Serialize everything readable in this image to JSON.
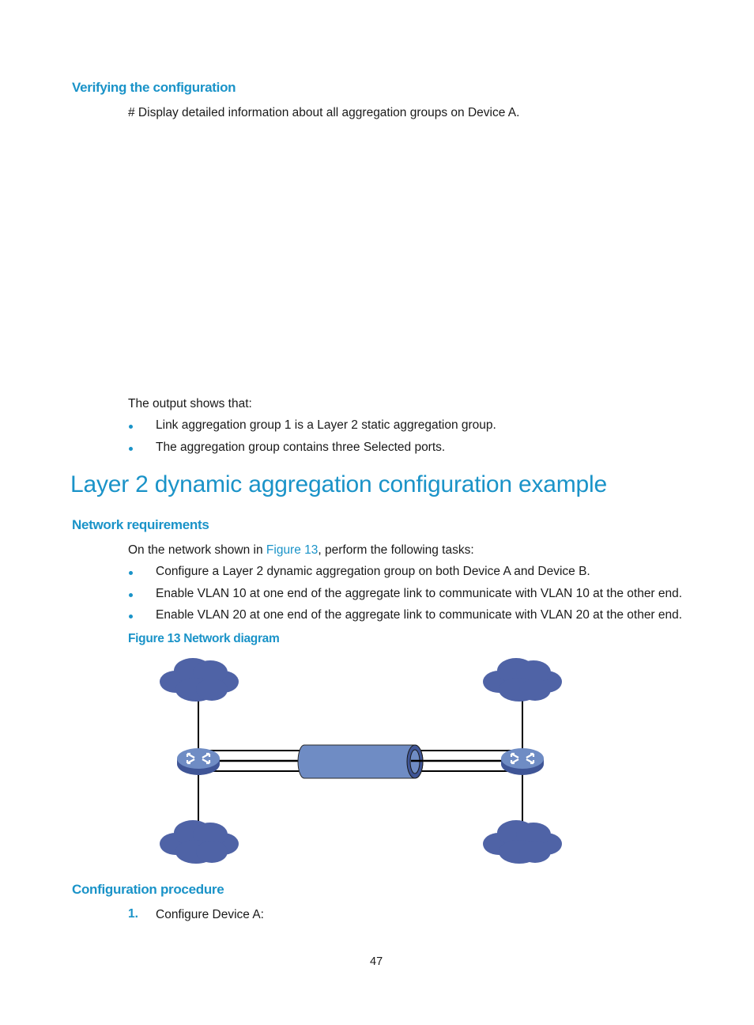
{
  "sections": {
    "verifying": {
      "heading": "Verifying the configuration",
      "intro": "# Display detailed information about all aggregation groups on Device A.",
      "output_lead": "The output shows that:",
      "bullets": [
        "Link aggregation group 1 is a Layer 2 static aggregation group.",
        "The aggregation group contains three Selected ports."
      ]
    },
    "example": {
      "title": "Layer 2 dynamic aggregation configuration example"
    },
    "network_requirements": {
      "heading": "Network requirements",
      "intro_before": "On the network shown in ",
      "intro_link": "Figure 13",
      "intro_after": ", perform the following tasks:",
      "bullets": [
        "Configure a Layer 2 dynamic aggregation group on both Device A and Device B.",
        "Enable VLAN 10 at one end of the aggregate link to communicate with VLAN 10 at the other end.",
        "Enable VLAN 20 at one end of the aggregate link to communicate with VLAN 20 at the other end."
      ],
      "figure_caption": "Figure 13 Network diagram"
    },
    "configuration_procedure": {
      "heading": "Configuration procedure",
      "steps": [
        {
          "number": "1.",
          "text": "Configure Device A:"
        }
      ]
    }
  },
  "diagram": {
    "nodes": [
      {
        "type": "cloud",
        "position": "top-left"
      },
      {
        "type": "cloud",
        "position": "bottom-left"
      },
      {
        "type": "cloud",
        "position": "top-right"
      },
      {
        "type": "cloud",
        "position": "bottom-right"
      },
      {
        "type": "switch",
        "position": "left"
      },
      {
        "type": "switch",
        "position": "right"
      },
      {
        "type": "aggregate-link-tube",
        "position": "center"
      }
    ],
    "colors": {
      "cloud": "#4f63a6",
      "switch_top": "#6f8cc4",
      "switch_side": "#3f5596",
      "tube": "#6f8cc4"
    }
  },
  "footer": {
    "page_number": "47"
  }
}
